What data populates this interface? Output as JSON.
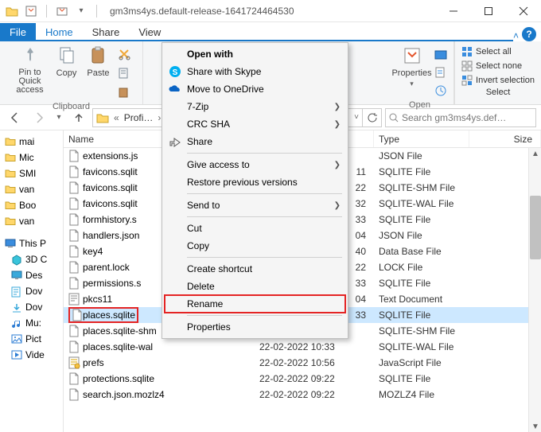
{
  "window": {
    "title": "gm3ms4ys.default-release-1641724464530",
    "qat_props": "Properties",
    "qat_new": "New folder"
  },
  "tabs": {
    "file": "File",
    "home": "Home",
    "share": "Share",
    "view": "View"
  },
  "ribbon": {
    "pin": "Pin to Quick access",
    "copy": "Copy",
    "paste": "Paste",
    "clipboard_label": "Clipboard",
    "properties": "Properties",
    "open": "Open",
    "open_label": "Open",
    "select_all": "Select all",
    "select_none": "Select none",
    "invert": "Invert selection",
    "select_label": "Select"
  },
  "nav": {
    "crumb1": "Profi…",
    "search_placeholder": "Search gm3ms4ys.def…"
  },
  "tree": {
    "items": [
      {
        "label": "mai",
        "kind": "folder"
      },
      {
        "label": "Mic",
        "kind": "folder"
      },
      {
        "label": "SMI",
        "kind": "folder"
      },
      {
        "label": "van",
        "kind": "folder"
      },
      {
        "label": "Boo",
        "kind": "folder"
      },
      {
        "label": "van",
        "kind": "folder"
      }
    ],
    "thispc": "This P",
    "pc_items": [
      {
        "label": "3D C",
        "icon": "cube",
        "color": "#39a9db"
      },
      {
        "label": "Des",
        "icon": "desktop",
        "color": "#39a9db"
      },
      {
        "label": "Dov",
        "icon": "doc",
        "color": "#39a9db"
      },
      {
        "label": "Dov",
        "icon": "download",
        "color": "#39a9db"
      },
      {
        "label": "Mu:",
        "icon": "music",
        "color": "#2a7bd3"
      },
      {
        "label": "Pict",
        "icon": "picture",
        "color": "#2a7bd3"
      },
      {
        "label": "Vide",
        "icon": "video",
        "color": "#2a7bd3"
      }
    ]
  },
  "columns": {
    "name": "Name",
    "date": "Date modified",
    "type": "Type",
    "size": "Size"
  },
  "files": [
    {
      "name": "extensions.js",
      "date": "",
      "type": "JSON File",
      "icon": "file",
      "trunc": true
    },
    {
      "name": "favicons.sqlit",
      "date": "11",
      "type": "SQLITE File",
      "icon": "file",
      "trunc": true
    },
    {
      "name": "favicons.sqlit",
      "date": "22",
      "type": "SQLITE-SHM File",
      "icon": "file",
      "trunc": true
    },
    {
      "name": "favicons.sqlit",
      "date": "32",
      "type": "SQLITE-WAL File",
      "icon": "file",
      "trunc": true
    },
    {
      "name": "formhistory.s",
      "date": "33",
      "type": "SQLITE File",
      "icon": "file",
      "trunc": true
    },
    {
      "name": "handlers.json",
      "date": "04",
      "type": "JSON File",
      "icon": "file",
      "trunc": true
    },
    {
      "name": "key4",
      "date": "40",
      "type": "Data Base File",
      "icon": "file"
    },
    {
      "name": "parent.lock",
      "date": "22",
      "type": "LOCK File",
      "icon": "file"
    },
    {
      "name": "permissions.s",
      "date": "33",
      "type": "SQLITE File",
      "icon": "file",
      "trunc": true
    },
    {
      "name": "pkcs11",
      "date": "04",
      "type": "Text Document",
      "icon": "text"
    },
    {
      "name": "places.sqlite",
      "date": "33",
      "type": "SQLITE File",
      "icon": "file",
      "selected": true,
      "highlight": true
    },
    {
      "name": "places.sqlite-shm",
      "date": "22-02-2022 09:22",
      "type": "SQLITE-SHM File",
      "icon": "file"
    },
    {
      "name": "places.sqlite-wal",
      "date": "22-02-2022 10:33",
      "type": "SQLITE-WAL File",
      "icon": "file"
    },
    {
      "name": "prefs",
      "date": "22-02-2022 10:56",
      "type": "JavaScript File",
      "icon": "js"
    },
    {
      "name": "protections.sqlite",
      "date": "22-02-2022 09:22",
      "type": "SQLITE File",
      "icon": "file"
    },
    {
      "name": "search.json.mozlz4",
      "date": "22-02-2022 09:22",
      "type": "MOZLZ4 File",
      "icon": "file"
    }
  ],
  "ctx": {
    "open_with": "Open with",
    "skype": "Share with Skype",
    "onedrive": "Move to OneDrive",
    "sevenzip": "7-Zip",
    "crc": "CRC SHA",
    "share": "Share",
    "give_access": "Give access to",
    "restore": "Restore previous versions",
    "send_to": "Send to",
    "cut": "Cut",
    "copy": "Copy",
    "shortcut": "Create shortcut",
    "delete": "Delete",
    "rename": "Rename",
    "properties": "Properties"
  }
}
